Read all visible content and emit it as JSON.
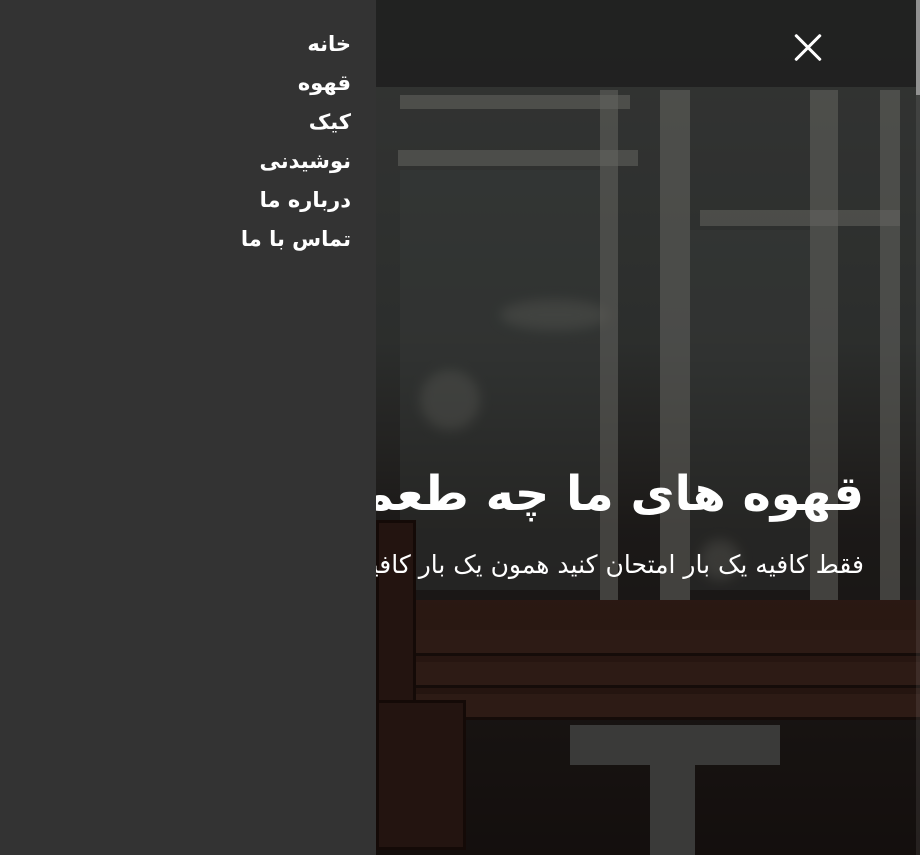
{
  "nav": {
    "items": [
      {
        "label": "خانه"
      },
      {
        "label": "قهوه"
      },
      {
        "label": "کیک"
      },
      {
        "label": "نوشیدنی"
      },
      {
        "label": "درباره ما"
      },
      {
        "label": "تماس با ما"
      }
    ]
  },
  "hero": {
    "title": "قهوه های ما چه طعمی دارند",
    "subtitle": "فقط کافیه یک بار امتحان کنید همون یک بار کافیه"
  },
  "icons": {
    "close": "close-icon"
  },
  "colors": {
    "sidebar_bg": "#333333",
    "text": "#ffffff"
  }
}
